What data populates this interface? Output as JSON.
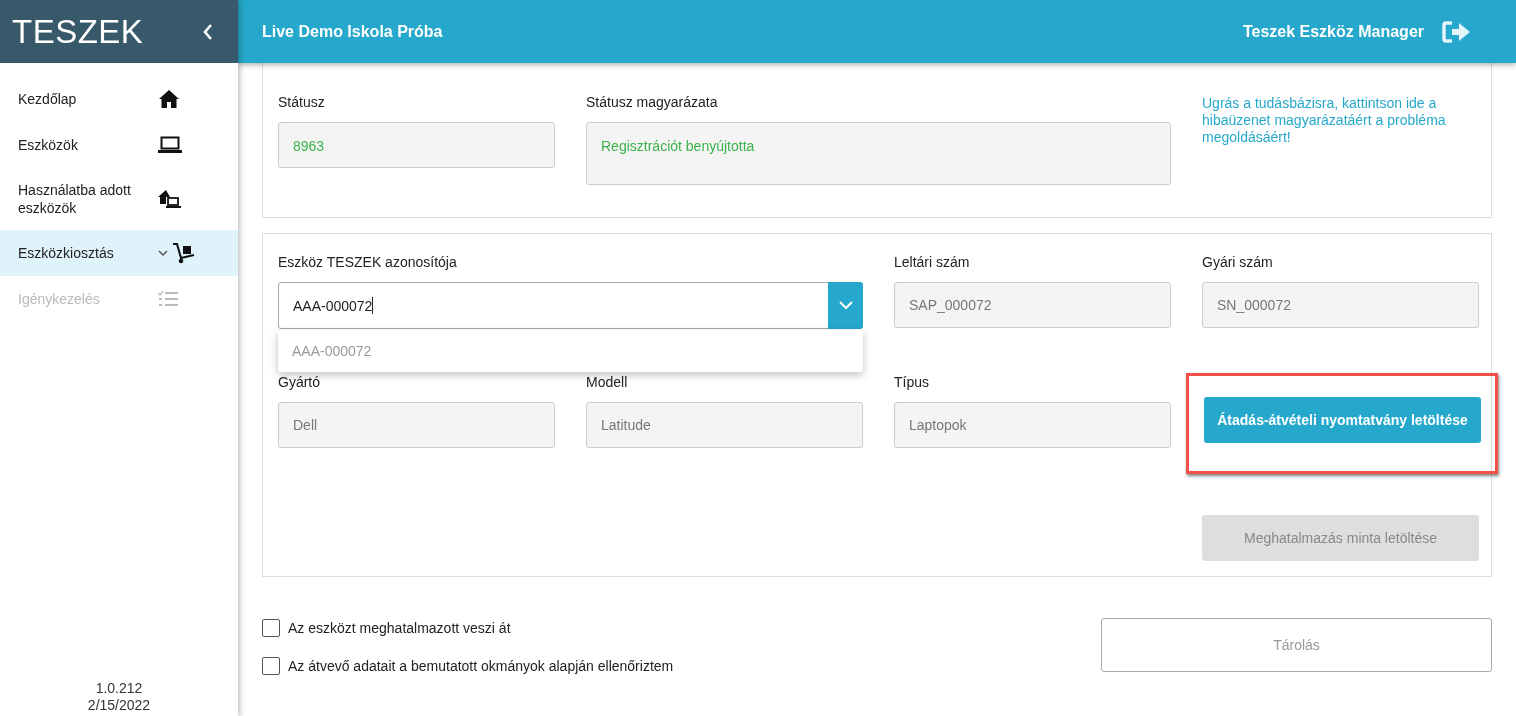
{
  "header": {
    "title": "Live Demo Iskola Próba",
    "app_name": "Teszek Eszköz Manager"
  },
  "sidebar": {
    "logo": "TESZEK",
    "items": [
      {
        "label": "Kezdőlap",
        "selected": false,
        "disabled": false,
        "expandable": false
      },
      {
        "label": "Eszközök",
        "selected": false,
        "disabled": false,
        "expandable": false
      },
      {
        "label": "Használatba adott eszközök",
        "selected": false,
        "disabled": false,
        "expandable": false
      },
      {
        "label": "Eszközkiosztás",
        "selected": true,
        "disabled": false,
        "expandable": true
      },
      {
        "label": "Igénykezelés",
        "selected": false,
        "disabled": true,
        "expandable": false
      }
    ],
    "version": "1.0.212",
    "date": "2/15/2022"
  },
  "status_section": {
    "status": {
      "label": "Státusz",
      "value": "8963"
    },
    "explanation": {
      "label": "Státusz magyarázata",
      "value": "Regisztrációt benyújtotta"
    },
    "help_link": "Ugrás a tudásbázisra, kattintson ide a hibaüzenet magyarázatáért a probléma megoldásáért!"
  },
  "device_section": {
    "id_field": {
      "label": "Eszköz TESZEK azonosítója",
      "value": "AAA-000072",
      "expanded": true,
      "options": [
        "AAA-000072"
      ]
    },
    "fields": [
      {
        "label": "Leltári szám",
        "value": "SAP_000072"
      },
      {
        "label": "Gyári szám",
        "value": "SN_000072"
      },
      {
        "label": "Gyártó",
        "value": "Dell"
      },
      {
        "label": "Modell",
        "value": "Latitude"
      },
      {
        "label": "Típus",
        "value": "Laptopok"
      }
    ],
    "download_button": {
      "label": "Átadás-átvételi nyomtatvány letöltése",
      "disabled": false
    },
    "authorization_button": {
      "label": "Meghatalmazás minta letöltése",
      "disabled": true
    }
  },
  "checkboxes": [
    {
      "label": "Az eszközt meghatalmazott veszi át",
      "checked": false
    },
    {
      "label": "Az átvevő adatait a bemutatott okmányok alapján ellenőriztem",
      "checked": false
    }
  ],
  "save_button": {
    "label": "Tárolás",
    "disabled": true
  }
}
